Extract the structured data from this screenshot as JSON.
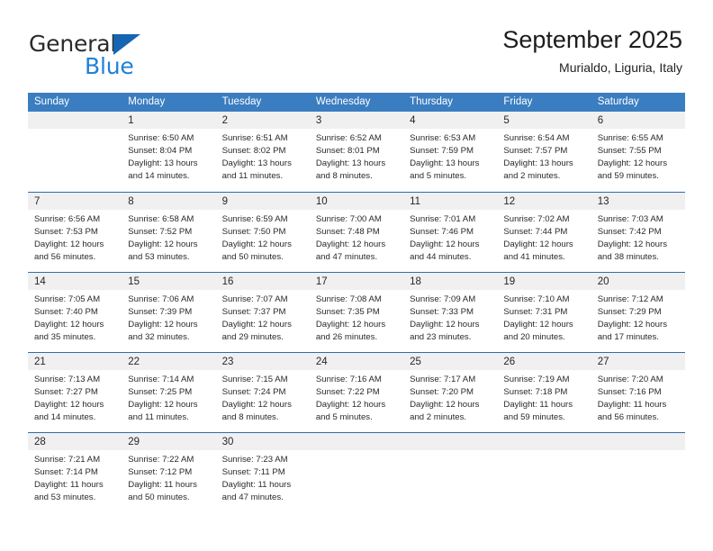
{
  "brand": {
    "name_part1": "General",
    "name_part2": "Blue",
    "accent_color": "#2080d8",
    "triangle_color": "#1665b3"
  },
  "header": {
    "title": "September 2025",
    "subtitle": "Murialdo, Liguria, Italy"
  },
  "calendar": {
    "header_bg": "#3a7dc0",
    "daynum_bg": "#f0f0f0",
    "weekdays": [
      "Sunday",
      "Monday",
      "Tuesday",
      "Wednesday",
      "Thursday",
      "Friday",
      "Saturday"
    ],
    "weeks": [
      [
        {
          "day": "",
          "lines": []
        },
        {
          "day": "1",
          "lines": [
            "Sunrise: 6:50 AM",
            "Sunset: 8:04 PM",
            "Daylight: 13 hours",
            "and 14 minutes."
          ]
        },
        {
          "day": "2",
          "lines": [
            "Sunrise: 6:51 AM",
            "Sunset: 8:02 PM",
            "Daylight: 13 hours",
            "and 11 minutes."
          ]
        },
        {
          "day": "3",
          "lines": [
            "Sunrise: 6:52 AM",
            "Sunset: 8:01 PM",
            "Daylight: 13 hours",
            "and 8 minutes."
          ]
        },
        {
          "day": "4",
          "lines": [
            "Sunrise: 6:53 AM",
            "Sunset: 7:59 PM",
            "Daylight: 13 hours",
            "and 5 minutes."
          ]
        },
        {
          "day": "5",
          "lines": [
            "Sunrise: 6:54 AM",
            "Sunset: 7:57 PM",
            "Daylight: 13 hours",
            "and 2 minutes."
          ]
        },
        {
          "day": "6",
          "lines": [
            "Sunrise: 6:55 AM",
            "Sunset: 7:55 PM",
            "Daylight: 12 hours",
            "and 59 minutes."
          ]
        }
      ],
      [
        {
          "day": "7",
          "lines": [
            "Sunrise: 6:56 AM",
            "Sunset: 7:53 PM",
            "Daylight: 12 hours",
            "and 56 minutes."
          ]
        },
        {
          "day": "8",
          "lines": [
            "Sunrise: 6:58 AM",
            "Sunset: 7:52 PM",
            "Daylight: 12 hours",
            "and 53 minutes."
          ]
        },
        {
          "day": "9",
          "lines": [
            "Sunrise: 6:59 AM",
            "Sunset: 7:50 PM",
            "Daylight: 12 hours",
            "and 50 minutes."
          ]
        },
        {
          "day": "10",
          "lines": [
            "Sunrise: 7:00 AM",
            "Sunset: 7:48 PM",
            "Daylight: 12 hours",
            "and 47 minutes."
          ]
        },
        {
          "day": "11",
          "lines": [
            "Sunrise: 7:01 AM",
            "Sunset: 7:46 PM",
            "Daylight: 12 hours",
            "and 44 minutes."
          ]
        },
        {
          "day": "12",
          "lines": [
            "Sunrise: 7:02 AM",
            "Sunset: 7:44 PM",
            "Daylight: 12 hours",
            "and 41 minutes."
          ]
        },
        {
          "day": "13",
          "lines": [
            "Sunrise: 7:03 AM",
            "Sunset: 7:42 PM",
            "Daylight: 12 hours",
            "and 38 minutes."
          ]
        }
      ],
      [
        {
          "day": "14",
          "lines": [
            "Sunrise: 7:05 AM",
            "Sunset: 7:40 PM",
            "Daylight: 12 hours",
            "and 35 minutes."
          ]
        },
        {
          "day": "15",
          "lines": [
            "Sunrise: 7:06 AM",
            "Sunset: 7:39 PM",
            "Daylight: 12 hours",
            "and 32 minutes."
          ]
        },
        {
          "day": "16",
          "lines": [
            "Sunrise: 7:07 AM",
            "Sunset: 7:37 PM",
            "Daylight: 12 hours",
            "and 29 minutes."
          ]
        },
        {
          "day": "17",
          "lines": [
            "Sunrise: 7:08 AM",
            "Sunset: 7:35 PM",
            "Daylight: 12 hours",
            "and 26 minutes."
          ]
        },
        {
          "day": "18",
          "lines": [
            "Sunrise: 7:09 AM",
            "Sunset: 7:33 PM",
            "Daylight: 12 hours",
            "and 23 minutes."
          ]
        },
        {
          "day": "19",
          "lines": [
            "Sunrise: 7:10 AM",
            "Sunset: 7:31 PM",
            "Daylight: 12 hours",
            "and 20 minutes."
          ]
        },
        {
          "day": "20",
          "lines": [
            "Sunrise: 7:12 AM",
            "Sunset: 7:29 PM",
            "Daylight: 12 hours",
            "and 17 minutes."
          ]
        }
      ],
      [
        {
          "day": "21",
          "lines": [
            "Sunrise: 7:13 AM",
            "Sunset: 7:27 PM",
            "Daylight: 12 hours",
            "and 14 minutes."
          ]
        },
        {
          "day": "22",
          "lines": [
            "Sunrise: 7:14 AM",
            "Sunset: 7:25 PM",
            "Daylight: 12 hours",
            "and 11 minutes."
          ]
        },
        {
          "day": "23",
          "lines": [
            "Sunrise: 7:15 AM",
            "Sunset: 7:24 PM",
            "Daylight: 12 hours",
            "and 8 minutes."
          ]
        },
        {
          "day": "24",
          "lines": [
            "Sunrise: 7:16 AM",
            "Sunset: 7:22 PM",
            "Daylight: 12 hours",
            "and 5 minutes."
          ]
        },
        {
          "day": "25",
          "lines": [
            "Sunrise: 7:17 AM",
            "Sunset: 7:20 PM",
            "Daylight: 12 hours",
            "and 2 minutes."
          ]
        },
        {
          "day": "26",
          "lines": [
            "Sunrise: 7:19 AM",
            "Sunset: 7:18 PM",
            "Daylight: 11 hours",
            "and 59 minutes."
          ]
        },
        {
          "day": "27",
          "lines": [
            "Sunrise: 7:20 AM",
            "Sunset: 7:16 PM",
            "Daylight: 11 hours",
            "and 56 minutes."
          ]
        }
      ],
      [
        {
          "day": "28",
          "lines": [
            "Sunrise: 7:21 AM",
            "Sunset: 7:14 PM",
            "Daylight: 11 hours",
            "and 53 minutes."
          ]
        },
        {
          "day": "29",
          "lines": [
            "Sunrise: 7:22 AM",
            "Sunset: 7:12 PM",
            "Daylight: 11 hours",
            "and 50 minutes."
          ]
        },
        {
          "day": "30",
          "lines": [
            "Sunrise: 7:23 AM",
            "Sunset: 7:11 PM",
            "Daylight: 11 hours",
            "and 47 minutes."
          ]
        },
        {
          "day": "",
          "lines": []
        },
        {
          "day": "",
          "lines": []
        },
        {
          "day": "",
          "lines": []
        },
        {
          "day": "",
          "lines": []
        }
      ]
    ]
  }
}
